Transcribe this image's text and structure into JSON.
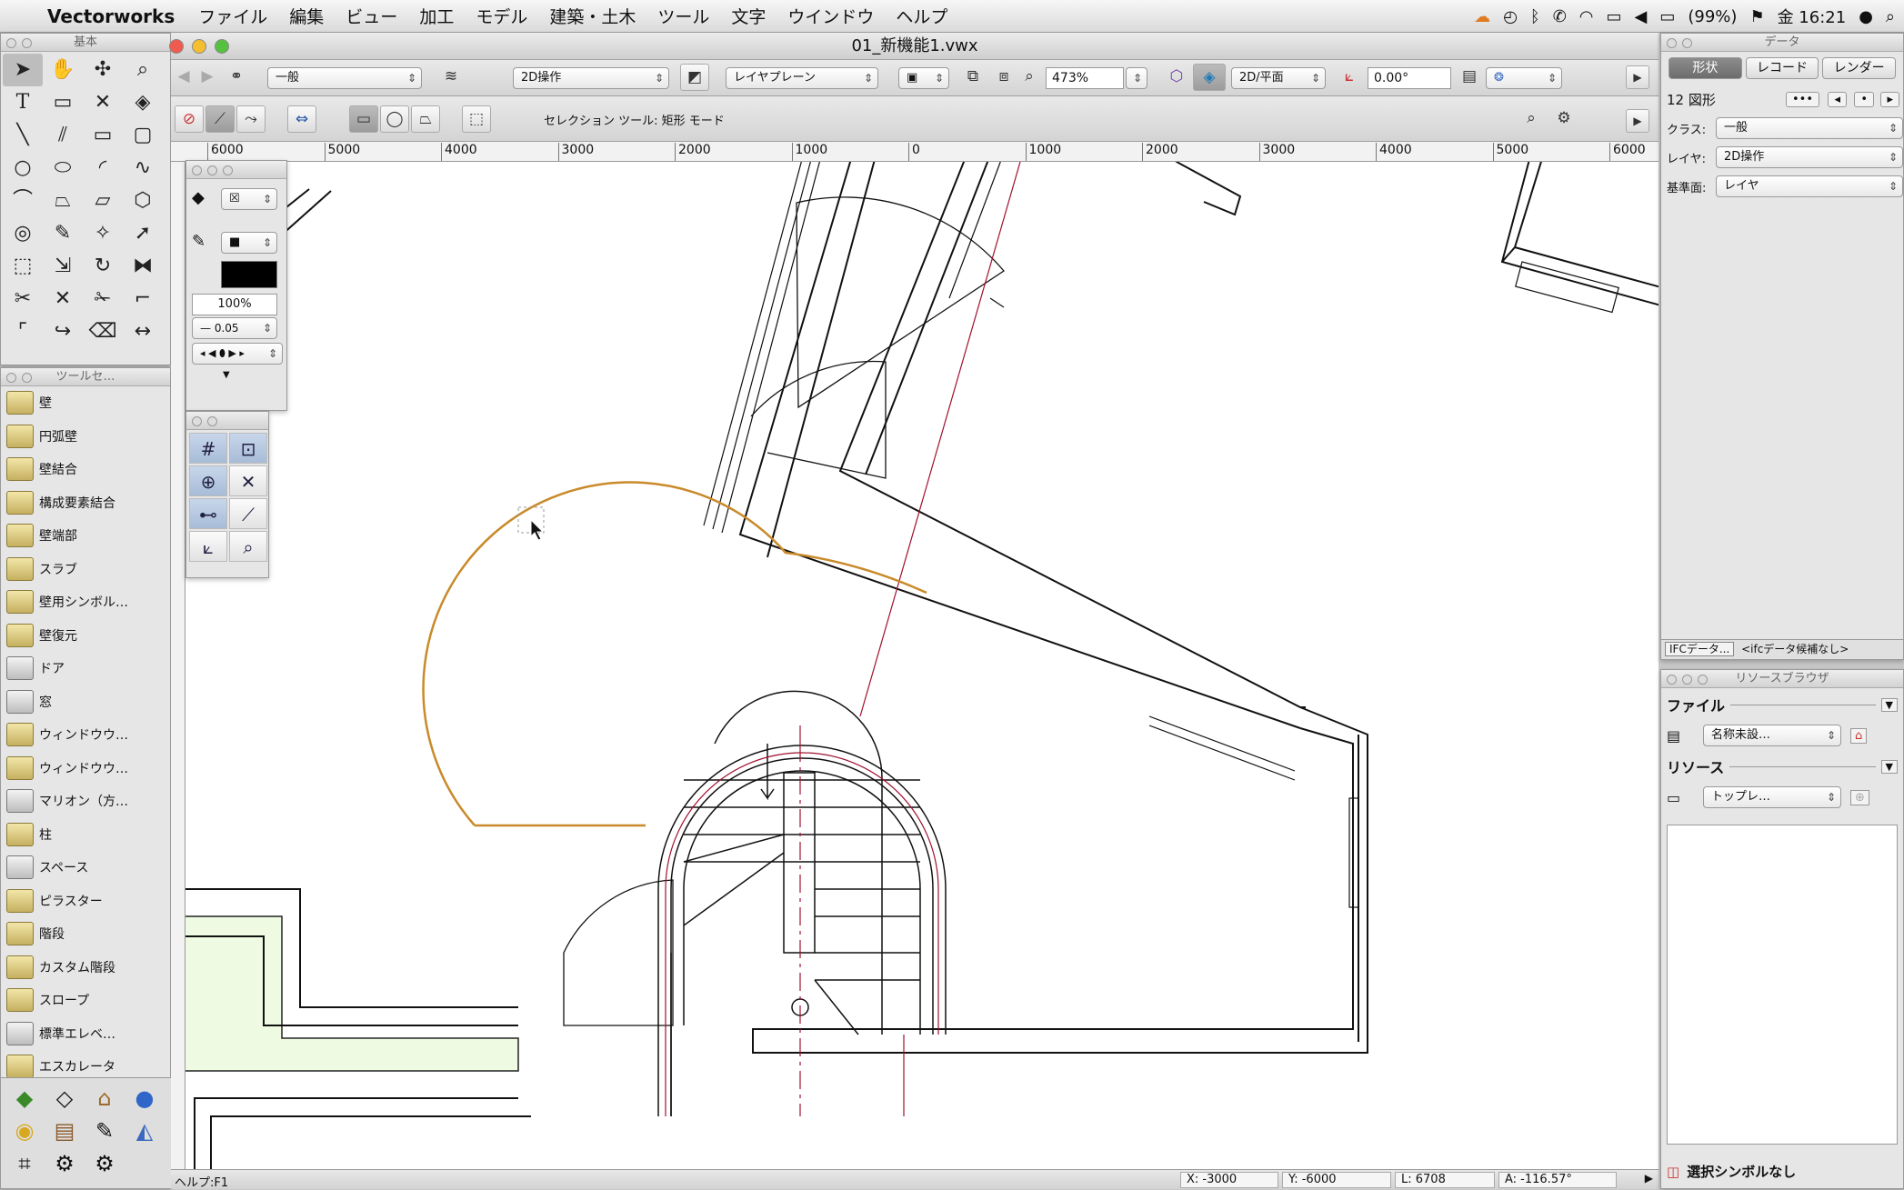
{
  "menubar": {
    "app_name": "Vectorworks",
    "items": [
      "ファイル",
      "編集",
      "ビュー",
      "加工",
      "モデル",
      "建築・土木",
      "ツール",
      "文字",
      "ウインドウ",
      "ヘルプ"
    ],
    "battery": "(99%)",
    "clock": "金 16:21"
  },
  "window": {
    "title": "01_新機能1.vwx"
  },
  "viewbar": {
    "class_popup": "一般",
    "layer_popup": "2D操作",
    "plane_popup": "レイヤプレーン",
    "zoom": "473%",
    "view_popup": "2D/平面",
    "rotation": "0.00°"
  },
  "modebar": {
    "label": "セレクション ツール: 矩形 モード"
  },
  "ruler": {
    "labels": [
      "6000",
      "5000",
      "4000",
      "3000",
      "2000",
      "1000",
      "0",
      "1000",
      "2000",
      "3000",
      "4000",
      "5000",
      "6000"
    ]
  },
  "palettes": {
    "basic_title": "基本",
    "toolset_title": "ツールセ…",
    "attr_opacity": "100%",
    "attr_line": "0.05"
  },
  "toolset": {
    "items": [
      {
        "label": "壁",
        "icon": "wall-icon"
      },
      {
        "label": "円弧壁",
        "icon": "round-wall-icon"
      },
      {
        "label": "壁結合",
        "icon": "wall-join-icon"
      },
      {
        "label": "構成要素結合",
        "icon": "component-join-icon"
      },
      {
        "label": "壁端部",
        "icon": "wall-end-icon"
      },
      {
        "label": "スラブ",
        "icon": "slab-icon"
      },
      {
        "label": "壁用シンボル…",
        "icon": "wall-symbol-icon"
      },
      {
        "label": "壁復元",
        "icon": "wall-reset-icon"
      },
      {
        "label": "ドア",
        "icon": "door-icon"
      },
      {
        "label": "窓",
        "icon": "window-icon"
      },
      {
        "label": "ウィンドウウ…",
        "icon": "window-wall-icon"
      },
      {
        "label": "ウィンドウウ…",
        "icon": "window-wall-2-icon"
      },
      {
        "label": "マリオン（方…",
        "icon": "mullion-icon"
      },
      {
        "label": "柱",
        "icon": "column-icon"
      },
      {
        "label": "スペース",
        "icon": "space-icon"
      },
      {
        "label": "ピラスター",
        "icon": "pilaster-icon"
      },
      {
        "label": "階段",
        "icon": "stair-icon"
      },
      {
        "label": "カスタム階段",
        "icon": "custom-stair-icon"
      },
      {
        "label": "スロープ",
        "icon": "ramp-icon"
      },
      {
        "label": "標準エレベ…",
        "icon": "elevator-icon"
      },
      {
        "label": "エスカレータ",
        "icon": "escalator-icon"
      }
    ]
  },
  "data_palette": {
    "title": "データ",
    "tabs": [
      "形状",
      "レコード",
      "レンダー"
    ],
    "object": "12 図形",
    "class_label": "クラス:",
    "class_value": "一般",
    "layer_label": "レイヤ:",
    "layer_value": "2D操作",
    "plane_label": "基準面:",
    "plane_value": "レイヤ",
    "ifc_button": "IFCデータ...",
    "ifc_status": "<ifcデータ候補なし>"
  },
  "resource_palette": {
    "title": "リソースブラウザ",
    "file_section": "ファイル",
    "file_popup": "名称未設…",
    "resource_section": "リソース",
    "resource_popup": "トップレ…",
    "selection": "選択シンボルなし"
  },
  "status": {
    "help": "ヘルプ:F1",
    "x": "X: -3000",
    "y": "Y: -6000",
    "l": "L: 6708",
    "a": "A: -116.57°"
  }
}
